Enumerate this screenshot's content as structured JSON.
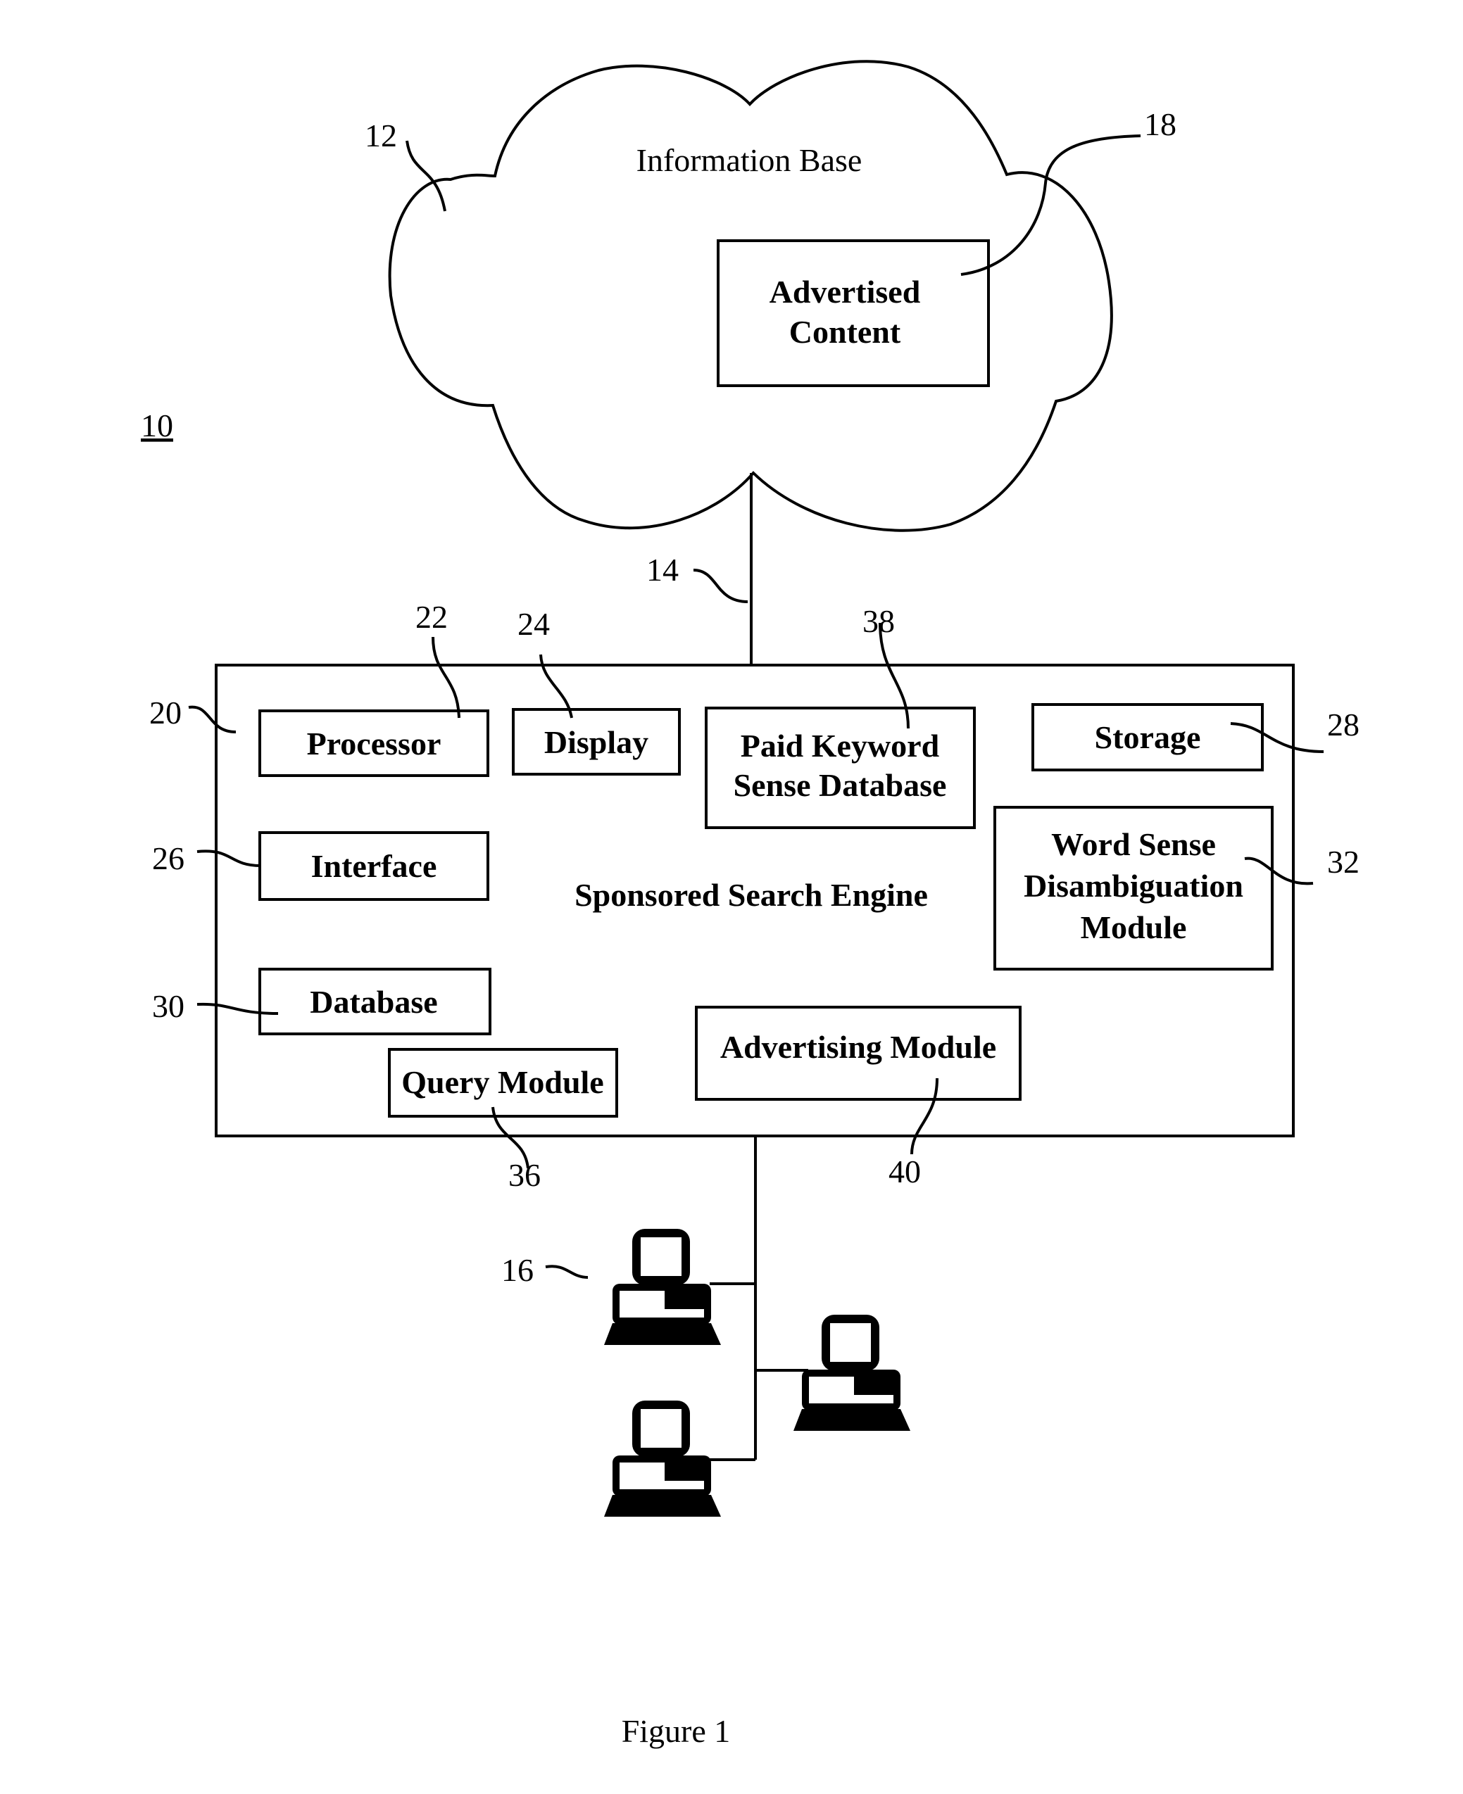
{
  "figure": {
    "caption": "Figure 1",
    "system_ref": "10"
  },
  "cloud": {
    "ref": "12",
    "title": "Information Base",
    "advertised_content": {
      "ref": "18",
      "lines": [
        "Advertised",
        "Content"
      ]
    }
  },
  "link": {
    "ref": "14"
  },
  "engine": {
    "ref": "20",
    "title": "Sponsored Search Engine",
    "modules": {
      "processor": {
        "ref": "22",
        "lines": [
          "Processor"
        ]
      },
      "display": {
        "ref": "24",
        "lines": [
          "Display"
        ]
      },
      "paid_keyword": {
        "ref": "38",
        "lines": [
          "Paid Keyword",
          "Sense Database"
        ]
      },
      "storage": {
        "ref": "28",
        "lines": [
          "Storage"
        ]
      },
      "interface": {
        "ref": "26",
        "lines": [
          "Interface"
        ]
      },
      "wsd": {
        "ref": "32",
        "lines": [
          "Word Sense",
          "Disambiguation",
          "Module"
        ]
      },
      "database": {
        "ref": "30",
        "lines": [
          "Database"
        ]
      },
      "query": {
        "ref": "36",
        "lines": [
          "Query Module"
        ]
      },
      "advertising": {
        "ref": "40",
        "lines": [
          "Advertising Module"
        ]
      }
    }
  },
  "clients": {
    "ref": "16",
    "count": 3
  }
}
